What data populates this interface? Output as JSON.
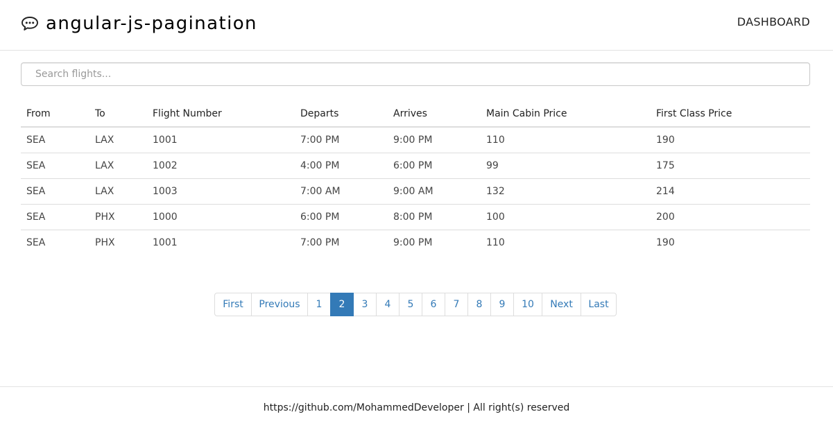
{
  "header": {
    "brand_icon": "chat-bubble-icon",
    "title": "angular-js-pagination",
    "nav_label": "DASHBOARD"
  },
  "search": {
    "value": "",
    "placeholder": "Search flights..."
  },
  "table": {
    "columns": [
      "From",
      "To",
      "Flight Number",
      "Departs",
      "Arrives",
      "Main Cabin Price",
      "First Class Price"
    ],
    "rows": [
      [
        "SEA",
        "LAX",
        "1001",
        "7:00 PM",
        "9:00 PM",
        "110",
        "190"
      ],
      [
        "SEA",
        "LAX",
        "1002",
        "4:00 PM",
        "6:00 PM",
        "99",
        "175"
      ],
      [
        "SEA",
        "LAX",
        "1003",
        "7:00 AM",
        "9:00 AM",
        "132",
        "214"
      ],
      [
        "SEA",
        "PHX",
        "1000",
        "6:00 PM",
        "8:00 PM",
        "100",
        "200"
      ],
      [
        "SEA",
        "PHX",
        "1001",
        "7:00 PM",
        "9:00 PM",
        "110",
        "190"
      ]
    ]
  },
  "pagination": {
    "first": "First",
    "previous": "Previous",
    "pages": [
      "1",
      "2",
      "3",
      "4",
      "5",
      "6",
      "7",
      "8",
      "9",
      "10"
    ],
    "current": "2",
    "next": "Next",
    "last": "Last",
    "accent_color": "#337ab7"
  },
  "footer": {
    "text": "https://github.com/MohammedDeveloper | All right(s) reserved"
  }
}
